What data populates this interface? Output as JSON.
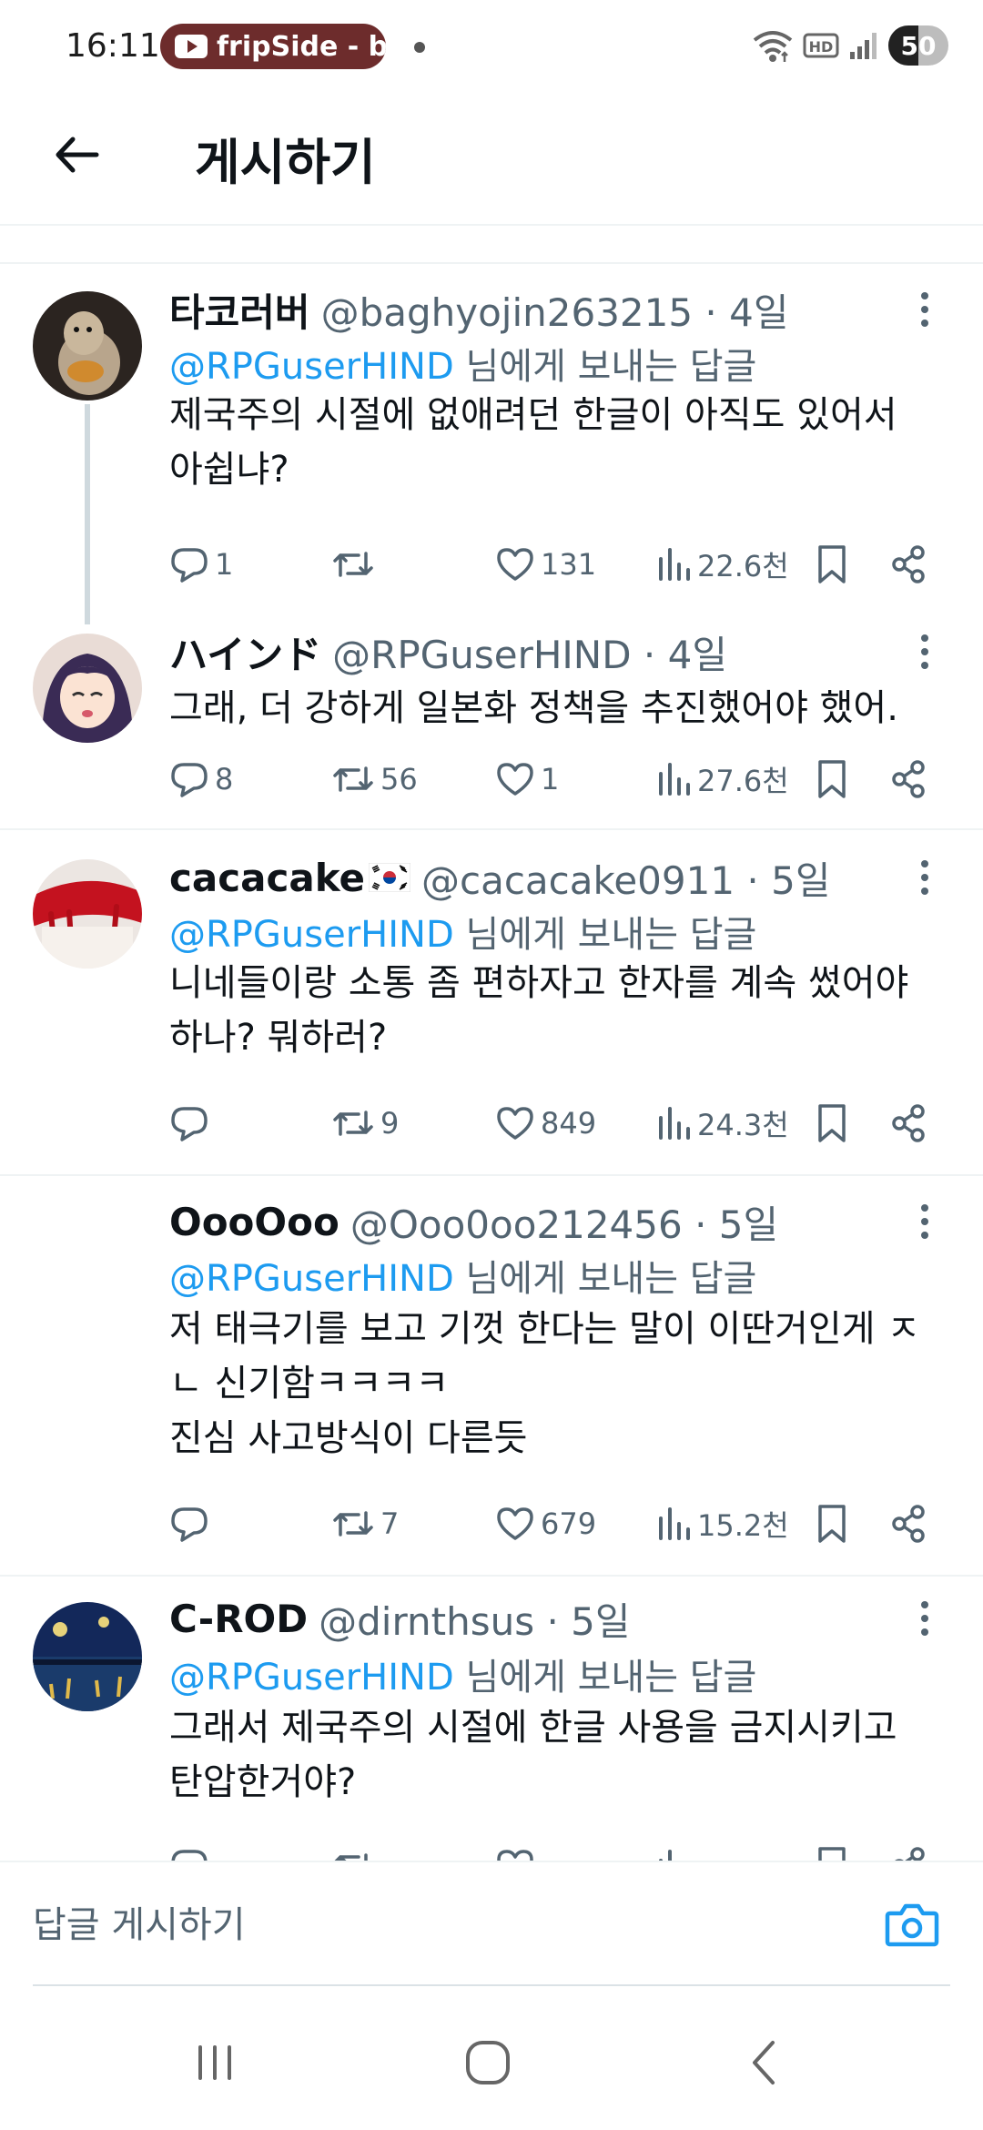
{
  "status_bar": {
    "time": "16:11",
    "media_label": "fripSide - b",
    "battery": "50",
    "battery_level": 0.5
  },
  "header": {
    "title": "게시하기"
  },
  "tweets": [
    {
      "name": "타코러버",
      "handle": "@baghyojin263215 · 4일",
      "reply_to": "@RPGuserHIND",
      "reply_suffix": " 님에게 보내는 답글",
      "body": "제국주의 시절에 없애려던 한글이 아직도 있어서\n아쉽냐?",
      "replies": "1",
      "retweets": "",
      "likes": "131",
      "views": "22.6천"
    },
    {
      "name": "ハインド",
      "handle": "@RPGuserHIND · 4일",
      "reply_to": "",
      "reply_suffix": "",
      "body": "그래, 더 강하게 일본화 정책을 추진했어야 했어.",
      "replies": "8",
      "retweets": "56",
      "likes": "1",
      "views": "27.6천"
    },
    {
      "name": "cacacake",
      "handle": "@cacacake0911 · 5일",
      "reply_to": "@RPGuserHIND",
      "reply_suffix": " 님에게 보내는 답글",
      "body": "니네들이랑 소통 좀 편하자고 한자를 계속 썼어야\n하나? 뭐하러?",
      "replies": "",
      "retweets": "9",
      "likes": "849",
      "views": "24.3천"
    },
    {
      "name": "OooOoo",
      "handle": "@Ooo0oo212456 · 5일",
      "reply_to": "@RPGuserHIND",
      "reply_suffix": " 님에게 보내는 답글",
      "body": "저 태극기를 보고 기껏 한다는 말이 이딴거인게 ㅈ\nㄴ 신기함ㅋㅋㅋㅋ\n진심 사고방식이 다른듯",
      "replies": "",
      "retweets": "7",
      "likes": "679",
      "views": "15.2천"
    },
    {
      "name": "C-ROD",
      "handle": "@dirnthsus · 5일",
      "reply_to": "@RPGuserHIND",
      "reply_suffix": " 님에게 보내는 답글",
      "body": "그래서 제국주의 시절에 한글 사용을 금지시키고\n탄압한거야?",
      "replies": "",
      "retweets": "",
      "likes": "",
      "views": ""
    }
  ],
  "reply_bar": {
    "placeholder": "답글 게시하기"
  },
  "icons": {
    "back": "arrow-left-icon",
    "more": "more-vertical-icon",
    "reply": "comment-icon",
    "retweet": "retweet-icon",
    "like": "heart-icon",
    "views": "bar-chart-icon",
    "bookmark": "bookmark-icon",
    "share": "share-icon",
    "camera": "camera-icon"
  },
  "colors": {
    "link": "#1d9bf0",
    "secondary_text": "#536471",
    "media_chip": "#6d2c2c"
  }
}
